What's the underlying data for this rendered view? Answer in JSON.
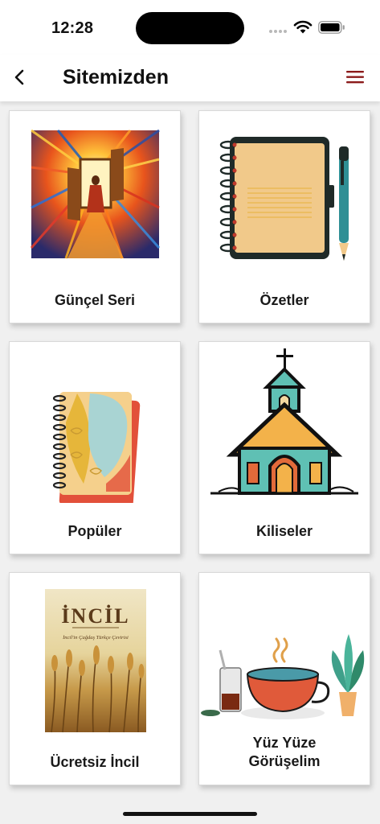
{
  "status_bar": {
    "time": "12:28"
  },
  "header": {
    "title": "Sitemizden",
    "back_icon": "chevron-left-icon",
    "menu_icon": "hamburger-menu-icon",
    "accent_color": "#8b1a1a"
  },
  "cards": [
    {
      "label": "Günçel Seri",
      "image": "sunburst-doorway-figure-art"
    },
    {
      "label": "Özetler",
      "image": "spiral-notebook-and-pen"
    },
    {
      "label": "Popüler",
      "image": "decorative-spiral-notebook"
    },
    {
      "label": "Kiliseler",
      "image": "church-with-cross"
    },
    {
      "label": "Ücretsiz İncil",
      "image": "incil-book-cover-wheat",
      "book_title": "İNCİL",
      "book_subtitle": "İncil'in Çağdaş Türkçe Çevirisi"
    },
    {
      "label_line1": "Yüz Yüze",
      "label_line2": "Görüşelim",
      "image": "tea-cup-coffee-and-plant"
    }
  ]
}
